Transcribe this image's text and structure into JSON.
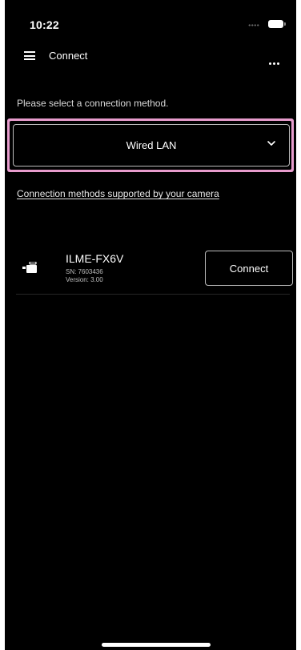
{
  "status_bar": {
    "time": "10:22",
    "signal_icon": "signal-dots-icon",
    "battery_icon": "battery-icon"
  },
  "nav": {
    "menu_icon": "hamburger-menu-icon",
    "title": "Connect",
    "more_icon": "more-horizontal-icon"
  },
  "main": {
    "prompt": "Please select a connection method.",
    "connection_method": {
      "selected": "Wired LAN",
      "icon": "chevron-down-icon",
      "highlight_color": "#e79ccd"
    },
    "supported_link": "Connection methods supported by your camera",
    "devices": [
      {
        "icon": "camera-icon",
        "name": "ILME-FX6V",
        "serial": "SN: 7603436",
        "version": "Version: 3.00",
        "action_label": "Connect"
      }
    ]
  },
  "colors": {
    "background": "#000000",
    "text": "#ffffff",
    "border": "#bdbdbd"
  }
}
